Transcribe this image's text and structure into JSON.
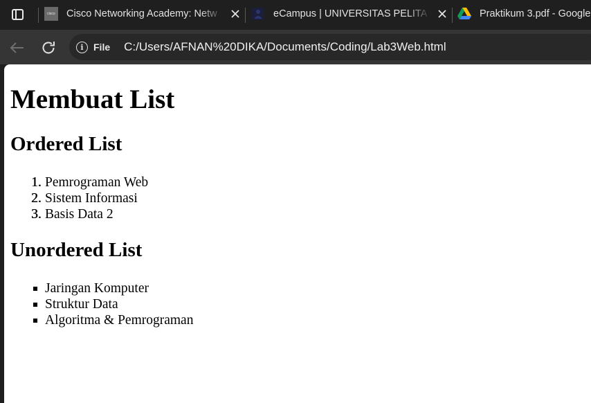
{
  "browser": {
    "tabs": [
      {
        "title": "Cisco Networking Academy: Netw",
        "favicon": "cisco-icon",
        "active": false
      },
      {
        "title": "eCampus | UNIVERSITAS PELITA B",
        "favicon": "ecampus-icon",
        "active": false
      },
      {
        "title": "Praktikum 3.pdf - Google",
        "favicon": "google-drive-icon",
        "active": false
      }
    ],
    "cisco_favicon_text": "cisco",
    "address": {
      "chip": "File",
      "url": "C:/Users/AFNAN%20DIKA/Documents/Coding/Lab3Web.html"
    }
  },
  "page": {
    "h1": "Membuat List",
    "ordered": {
      "heading": "Ordered List",
      "items": [
        {
          "marker": "1.",
          "text": "Pemrograman Web"
        },
        {
          "marker": "2.",
          "text": "Sistem Informasi"
        },
        {
          "marker": "3.",
          "text": "Basis Data 2"
        }
      ]
    },
    "unordered": {
      "heading": "Unordered List",
      "items": [
        {
          "text": "Jaringan Komputer"
        },
        {
          "text": "Struktur Data"
        },
        {
          "text": "Algoritma & Pemrograman"
        }
      ]
    }
  },
  "colors": {
    "tabstrip_bg": "#1f1f1f",
    "toolbar_bg": "#353535",
    "omnibox_bg": "#282828",
    "page_bg": "#ffffff"
  }
}
